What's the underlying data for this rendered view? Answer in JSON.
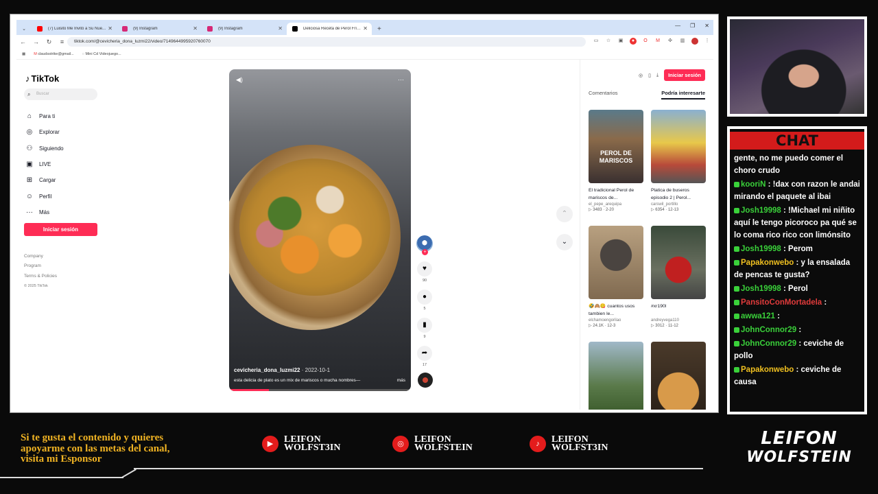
{
  "browser": {
    "tabs": [
      {
        "label": "(7) Luisito Me Invitó a Su Nue...",
        "color": "#ff0000",
        "active": false
      },
      {
        "label": "(9) Instagram",
        "color": "#d62976",
        "active": false
      },
      {
        "label": "(9) Instagram",
        "color": "#d62976",
        "active": false
      },
      {
        "label": "Deliciosa Receta de Perol Frío c...",
        "color": "#000000",
        "active": true
      }
    ],
    "url": "tiktok.com/@cevicheria_dona_luzmi22/video/7149644995920760070",
    "bookmarks": [
      "claudsstrike@gmail...",
      "Mini Cd Videojuego..."
    ]
  },
  "tiktok": {
    "logo": "TikTok",
    "search_placeholder": "Buscar",
    "menu": [
      {
        "label": "Para ti",
        "icon": "home-icon"
      },
      {
        "label": "Explorar",
        "icon": "compass-icon"
      },
      {
        "label": "Siguiendo",
        "icon": "user-follow-icon"
      },
      {
        "label": "LIVE",
        "icon": "live-icon"
      },
      {
        "label": "Cargar",
        "icon": "upload-icon"
      },
      {
        "label": "Perfil",
        "icon": "profile-icon"
      },
      {
        "label": "Más",
        "icon": "more-icon"
      }
    ],
    "login_button": "Iniciar sesión",
    "footer": [
      "Company",
      "Program",
      "Terms & Policies"
    ],
    "copyright": "© 2025 TikTok",
    "video": {
      "author": "cevicheria_dona_luzmi22",
      "date": "· 2022-10-1",
      "description": "esta delicia de plato es un mix de mariscos o mucha nombres—",
      "more": "más",
      "progress": 0.22
    },
    "actions": {
      "likes": "90",
      "comments": "5",
      "saves": "9",
      "shares": "17"
    },
    "right_panel": {
      "login_button": "Iniciar sesión",
      "tabs": [
        "Comentarios",
        "Podría interesarte"
      ],
      "cards": [
        {
          "caption": "El tradicional Perol de mariscos de...",
          "author": "el_pepe_arequipa",
          "meta": "▷ 3483 · 2-20",
          "overlay": "PEROL DE MARISCOS"
        },
        {
          "caption": "Platica de buseros episodio 2 | Perol...",
          "author": "carswil_portillo",
          "meta": "▷ 6354 · 12-13",
          "overlay": ""
        },
        {
          "caption": "🤣🙈😋 cuantos usos tambien le...",
          "author": "elchamoengorilao",
          "meta": "▷ 24.1K · 12-3",
          "overlay": ""
        },
        {
          "caption": "#xr190l",
          "author": "andreyvega110",
          "meta": "▷ 3012 · 11-12",
          "overlay": ""
        },
        {
          "caption": "",
          "author": "",
          "meta": "",
          "overlay": ""
        },
        {
          "caption": "",
          "author": "",
          "meta": "",
          "overlay": ""
        }
      ]
    }
  },
  "chat": {
    "title": "CHAT",
    "messages": [
      {
        "user": "",
        "text": "gente, no me puedo comer el choro crudo",
        "ucls": "u1"
      },
      {
        "user": "kooriN",
        "text": " : !dax con razon le andai mirando el paquete al ibai",
        "ucls": "u1"
      },
      {
        "user": "Josh19998",
        "text": " : !Michael mi niñito aquí le tengo picoroco pa qué se lo coma rico rico con limónsito",
        "ucls": "u1"
      },
      {
        "user": "Josh19998",
        "text": " : Perom",
        "ucls": "u1"
      },
      {
        "user": "Papakonwebo",
        "text": " : y la ensalada de pencas te gusta?",
        "ucls": "u3"
      },
      {
        "user": "Josh19998",
        "text": " : Perol",
        "ucls": "u1"
      },
      {
        "user": "PansitoConMortadela",
        "text": " :",
        "ucls": "u2"
      },
      {
        "user": "awwa121",
        "text": " :",
        "ucls": "u1"
      },
      {
        "user": "JohnConnor29",
        "text": " :",
        "ucls": "u1"
      },
      {
        "user": "JohnConnor29",
        "text": " : ceviche de pollo",
        "ucls": "u1"
      },
      {
        "user": "Papakonwebo",
        "text": " : ceviche de causa",
        "ucls": "u3"
      }
    ]
  },
  "overlay": {
    "sponsor_text": [
      "Si te gusta el contenido y quieres",
      "apoyarme con las metas del canal,",
      "visita mi Esponsor"
    ],
    "socials": [
      {
        "icon": "youtube-icon",
        "line1": "LEIFON",
        "line2": "WOLFST3IN"
      },
      {
        "icon": "instagram-icon",
        "line1": "LEIFON",
        "line2": "WOLFSTEIN"
      },
      {
        "icon": "tiktok-icon",
        "line1": "LEIFON",
        "line2": "WOLFST3IN"
      }
    ],
    "brand": [
      "LEIFON",
      "WOLFSTEIN"
    ]
  }
}
